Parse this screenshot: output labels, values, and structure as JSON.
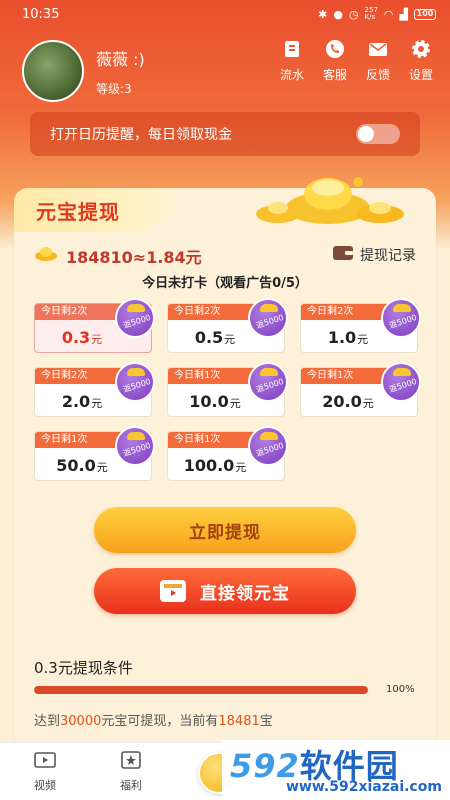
{
  "status_bar": {
    "time": "10:35",
    "net_speed": "257\nK/s",
    "battery": "100"
  },
  "profile": {
    "nickname": "薇薇 :)",
    "level": "等级:3"
  },
  "top_actions": [
    {
      "name": "flow",
      "label": "流水",
      "icon": "wallet-icon"
    },
    {
      "name": "service",
      "label": "客服",
      "icon": "phone-icon"
    },
    {
      "name": "feedback",
      "label": "反馈",
      "icon": "mail-icon"
    },
    {
      "name": "settings",
      "label": "设置",
      "icon": "gear-icon"
    }
  ],
  "calendar_reminder": {
    "text": "打开日历提醒，每日领取现金",
    "enabled": false
  },
  "card": {
    "title": "元宝提现",
    "balance": "184810≈1.84元",
    "history_label": "提现记录",
    "checkin_text": "今日未打卡（观看广告0/5）"
  },
  "options": [
    {
      "remaining": "今日剩2次",
      "amount": "0.3",
      "unit": "元",
      "badge": "返5000",
      "selected": true
    },
    {
      "remaining": "今日剩2次",
      "amount": "0.5",
      "unit": "元",
      "badge": "返5000",
      "selected": false
    },
    {
      "remaining": "今日剩2次",
      "amount": "1.0",
      "unit": "元",
      "badge": "返5000",
      "selected": false
    },
    {
      "remaining": "今日剩2次",
      "amount": "2.0",
      "unit": "元",
      "badge": "返5000",
      "selected": false
    },
    {
      "remaining": "今日剩1次",
      "amount": "10.0",
      "unit": "元",
      "badge": "返5000",
      "selected": false
    },
    {
      "remaining": "今日剩1次",
      "amount": "20.0",
      "unit": "元",
      "badge": "返5000",
      "selected": false
    },
    {
      "remaining": "今日剩1次",
      "amount": "50.0",
      "unit": "元",
      "badge": "返5000",
      "selected": false
    },
    {
      "remaining": "今日剩1次",
      "amount": "100.0",
      "unit": "元",
      "badge": "返5000",
      "selected": false
    }
  ],
  "buttons": {
    "withdraw": "立即提现",
    "claim": "直接领元宝"
  },
  "condition": {
    "title": "0.3元提现条件",
    "progress_percent": 100,
    "progress_label": "100%",
    "text_prefix": "达到",
    "text_highlight": "30000",
    "text_middle": "元宝可提现，当前有",
    "text_current": "18481",
    "text_suffix": "宝"
  },
  "tabbar": [
    {
      "label": "视频",
      "icon": "video-icon"
    },
    {
      "label": "福利",
      "icon": "star-icon"
    }
  ],
  "watermark": {
    "num": "592",
    "cn": "软件园",
    "url": "www.592xiazai.com"
  },
  "colors": {
    "primary_red": "#e94f2e",
    "gold": "#f7a21c",
    "badge_purple": "#7a3bc0"
  }
}
